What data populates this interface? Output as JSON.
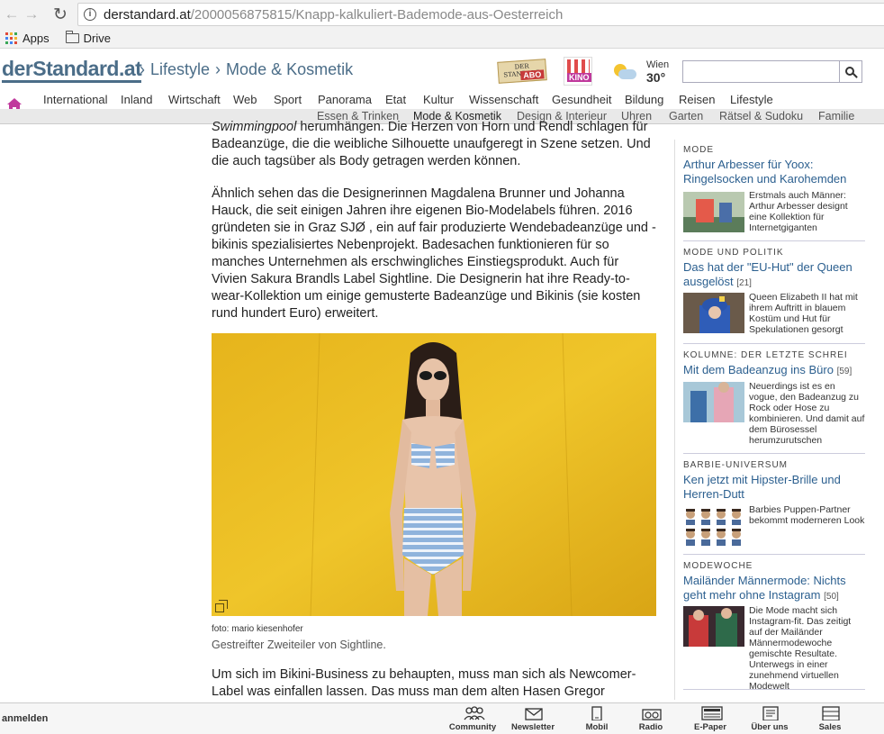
{
  "browser": {
    "url_host": "derstandard.at",
    "url_path": "/2000056875815/Knapp-kalkuliert-Bademode-aus-Oesterreich",
    "bookmarks": [
      {
        "label": "Apps"
      },
      {
        "label": "Drive"
      }
    ]
  },
  "header": {
    "logo": "derStandard.at",
    "crumb_sep": "›",
    "crumbs": [
      "Lifestyle",
      "Mode & Kosmetik"
    ],
    "abo_label": "ABO",
    "abo_brand": "DER STANDARD",
    "kino_label": "KINO",
    "weather_city": "Wien",
    "weather_temp": "30°",
    "search_placeholder": ""
  },
  "nav_main": [
    "International",
    "Inland",
    "Wirtschaft",
    "Web",
    "Sport",
    "Panorama",
    "Etat",
    "Kultur",
    "Wissenschaft",
    "Gesundheit",
    "Bildung",
    "Reisen",
    "Lifestyle"
  ],
  "nav_sub": [
    "Essen & Trinken",
    "Mode & Kosmetik",
    "Design & Interieur",
    "Uhren",
    "Garten",
    "Rätsel & Sudoku",
    "Familie"
  ],
  "article": {
    "p1_em": "Swimmingpool",
    "p1_rest": " herumhängen. Die Herzen von Horn und Rendl schlagen für Badeanzüge, die die weibliche Silhouette unaufgeregt in Szene setzen. Und die auch tagsüber als Body getragen werden können.",
    "p2": "Ähnlich sehen das die Designerinnen Magdalena Brunner und Johanna Hauck, die seit einigen Jahren ihre eigenen Bio-Modelabels führen. 2016 gründeten sie in Graz SJØ , ein auf fair produzierte Wendebadeanzüge und -bikinis spezialisiertes Nebenprojekt. Badesachen funktionieren für so manches Unternehmen als erschwingliches Einstiegsprodukt. Auch für Vivien Sakura Brandls Label Sightline. Die Designerin hat ihre Ready-to-wear-Kollektion um einige gemusterte Badeanzüge und Bikinis (sie kosten rund hundert Euro) erweitert.",
    "photo_credit": "foto: mario kiesenhofer",
    "photo_caption": "Gestreifter Zweiteiler von Sightline.",
    "p3": "Um sich im Bikini-Business zu behaupten, muss man sich als Newcomer-Label was einfallen lassen. Das muss man dem alten Hasen Gregor"
  },
  "sidebar": [
    {
      "head": "MODE",
      "title": "Arthur Arbesser für Yoox: Ringelsocken und Karohemden",
      "count": "",
      "text": "Erstmals auch Männer: Arthur Arbesser designt eine Kollektion für Internetgiganten"
    },
    {
      "head": "MODE UND POLITIK",
      "title": "Das hat der \"EU-Hut\" der Queen ausgelöst",
      "count": "[21]",
      "text": "Queen Elizabeth II hat mit ihrem Auftritt in blauem Kostüm und Hut für Spekulationen gesorgt"
    },
    {
      "head": "KOLUMNE: DER LETZTE SCHREI",
      "title": "Mit dem Badeanzug ins Büro",
      "count": "[59]",
      "text": "Neuerdings ist es en vogue, den Badeanzug zu Rock oder Hose zu kombinieren. Und damit auf dem Bürosessel herumzurutschen"
    },
    {
      "head": "BARBIE-UNIVERSUM",
      "title": "Ken jetzt mit Hipster-Brille und Herren-Dutt",
      "count": "",
      "text": "Barbies Puppen-Partner bekommt moderneren Look"
    },
    {
      "head": "MODEWOCHE",
      "title": "Mailänder Männermode: Nichts geht mehr ohne Instagram",
      "count": "[50]",
      "text": "Die Mode macht sich Instagram-fit. Das zeitigt auf der Mailänder Männermodewoche gemischte Resultate. Unterwegs in einer zunehmend virtuellen Modewelt"
    }
  ],
  "bottom": {
    "login": "anmelden",
    "items": [
      "Community",
      "Newsletter",
      "Mobil",
      "Radio",
      "E-Paper",
      "Über uns",
      "Sales"
    ]
  },
  "colors": {
    "accent": "#4b6d88",
    "link": "#2b5f8f",
    "lifestyle": "#c0399c",
    "photo_bg": "#e8b820"
  }
}
